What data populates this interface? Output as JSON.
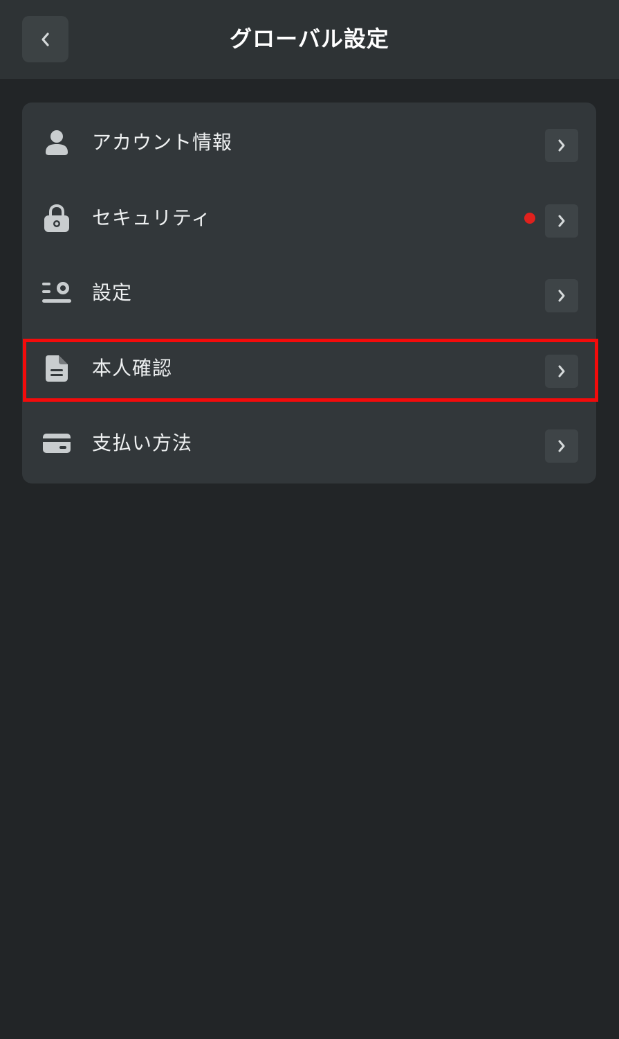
{
  "header": {
    "title": "グローバル設定",
    "back_icon": "chevron-left-icon"
  },
  "menu": {
    "items": [
      {
        "label": "アカウント情報",
        "icon": "user-icon",
        "chevron": "chevron-right-icon",
        "has_notification": false
      },
      {
        "label": "セキュリティ",
        "icon": "lock-icon",
        "chevron": "chevron-right-icon",
        "has_notification": true
      },
      {
        "label": "設定",
        "icon": "settings-sliders-icon",
        "chevron": "chevron-right-icon",
        "has_notification": false
      },
      {
        "label": "本人確認",
        "icon": "document-icon",
        "chevron": "chevron-right-icon",
        "has_notification": false,
        "highlighted": true
      },
      {
        "label": "支払い方法",
        "icon": "credit-card-icon",
        "chevron": "chevron-right-icon",
        "has_notification": false
      }
    ]
  },
  "colors": {
    "background": "#222527",
    "header": "#2e3335",
    "card": "#32373a",
    "notification_dot": "#e0211d",
    "highlight_border": "#f30b0b"
  }
}
